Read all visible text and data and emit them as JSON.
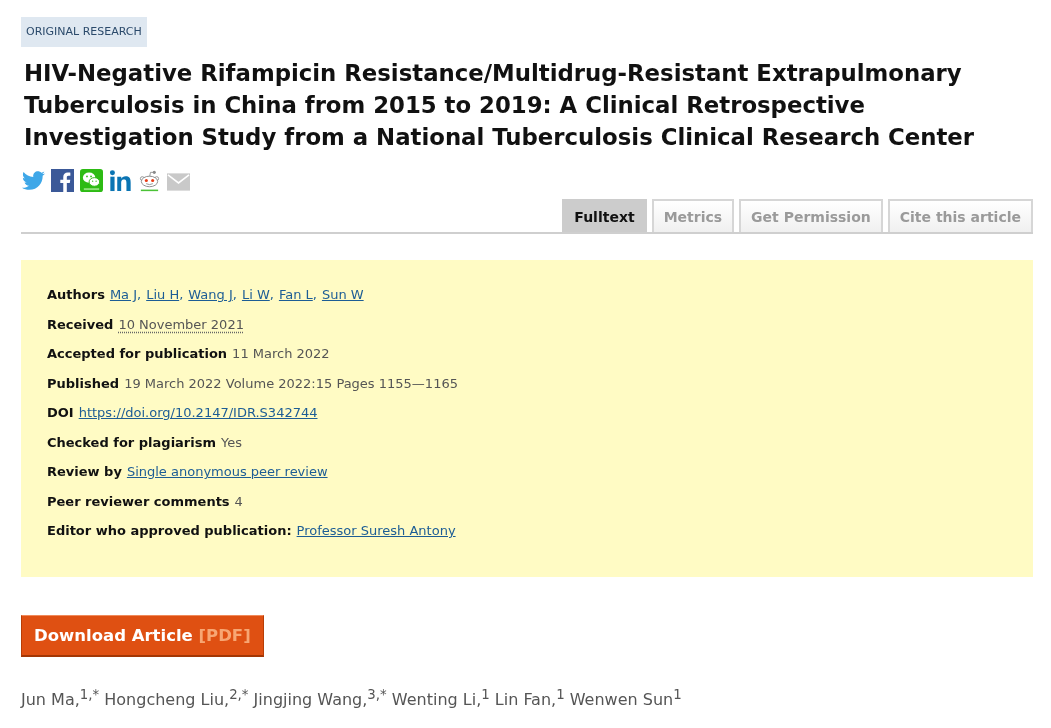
{
  "article_type": "ORIGINAL RESEARCH",
  "title": "HIV-Negative Rifampicin Resistance/Multidrug-Resistant Extrapulmonary Tuberculosis in China from 2015 to 2019: A Clinical Retrospective Investigation Study from a National Tuberculosis Clinical Research Center",
  "tabs": [
    {
      "label": "Fulltext",
      "selected": true
    },
    {
      "label": "Metrics",
      "selected": false
    },
    {
      "label": "Get Permission",
      "selected": false
    },
    {
      "label": "Cite this article",
      "selected": false
    }
  ],
  "details": [
    {
      "label": "Authors",
      "kind": "links",
      "links": [
        {
          "text": "Ma J",
          "suffix": ","
        },
        {
          "text": "Liu H",
          "suffix": ","
        },
        {
          "text": "Wang J",
          "suffix": ","
        },
        {
          "text": "Li W",
          "suffix": ","
        },
        {
          "text": "Fan L",
          "suffix": ","
        },
        {
          "text": "Sun W"
        }
      ]
    },
    {
      "label": "Received",
      "kind": "date",
      "value": "10 November 2021"
    },
    {
      "label": "Accepted for publication",
      "kind": "text",
      "value": "11 March 2022"
    },
    {
      "label": "Published",
      "kind": "text",
      "value": "19 March 2022 Volume 2022:15 Pages 1155—1165"
    },
    {
      "label": "DOI",
      "kind": "link",
      "value": "https://doi.org/10.2147/IDR.S342744"
    },
    {
      "label": "Checked for plagiarism",
      "kind": "text",
      "value": "Yes"
    },
    {
      "label": "Review by",
      "kind": "link",
      "value": "Single anonymous peer review"
    },
    {
      "label": "Peer reviewer comments",
      "kind": "text",
      "value": "4"
    },
    {
      "label": "Editor who approved publication:",
      "kind": "link",
      "value": "Professor Suresh Antony"
    }
  ],
  "download_button": {
    "label": "Download Article",
    "format": "[PDF]"
  },
  "authors_line": "Jun Ma,$^{1,*}$ Hongcheng Liu,$^{2,*}$ Jingjing Wang,$^{3,*}$ Wenting Li,$^{1}$ Lin Fan,$^{1}$ Wenwen Sun$^{1}$"
}
